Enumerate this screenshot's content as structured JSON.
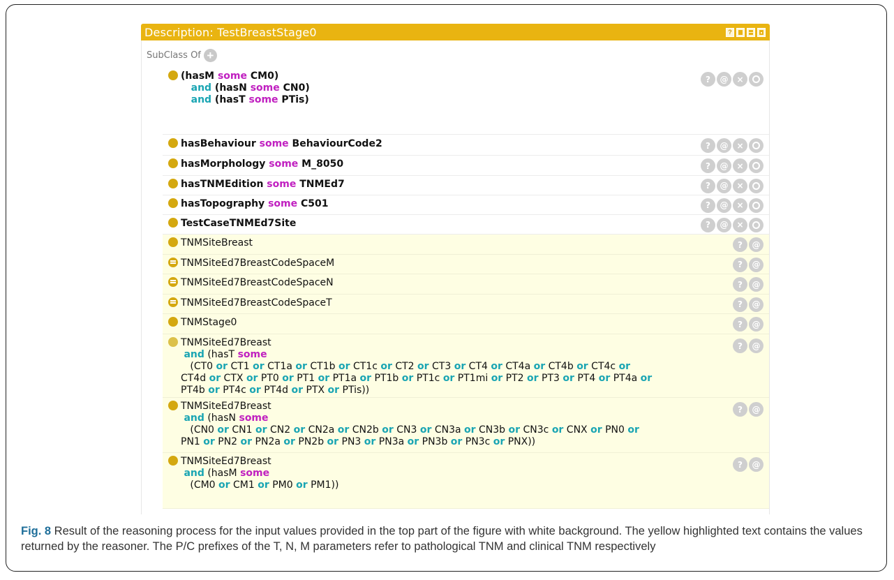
{
  "panel": {
    "title": "Description: TestBreastStage0",
    "title_buttons": [
      "?"
    ],
    "section_label": "SubClass Of",
    "add_icon": "plus-circle-icon"
  },
  "rows": [
    {
      "kind": "asserted",
      "dot": "plain",
      "lines": [
        [
          [
            "t",
            "(hasM "
          ],
          [
            "s",
            "some"
          ],
          [
            "t",
            " CM0)"
          ]
        ],
        [
          [
            "t",
            "   "
          ],
          [
            "a",
            "and"
          ],
          [
            "t",
            " (hasN "
          ],
          [
            "s",
            "some"
          ],
          [
            "t",
            " CN0)"
          ]
        ],
        [
          [
            "t",
            "   "
          ],
          [
            "a",
            "and"
          ],
          [
            "t",
            " (hasT "
          ],
          [
            "s",
            "some"
          ],
          [
            "t",
            " PTis)"
          ]
        ]
      ],
      "actions": [
        "?",
        "@",
        "×",
        "o"
      ]
    },
    {
      "kind": "asserted",
      "dot": "plain",
      "lines": [
        [
          [
            "t",
            "hasBehaviour "
          ],
          [
            "s",
            "some"
          ],
          [
            "t",
            " BehaviourCode2"
          ]
        ]
      ],
      "actions": [
        "?",
        "@",
        "×",
        "o"
      ]
    },
    {
      "kind": "asserted",
      "dot": "plain",
      "lines": [
        [
          [
            "t",
            "hasMorphology "
          ],
          [
            "s",
            "some"
          ],
          [
            "t",
            " M_8050"
          ]
        ]
      ],
      "actions": [
        "?",
        "@",
        "×",
        "o"
      ]
    },
    {
      "kind": "asserted",
      "dot": "plain",
      "lines": [
        [
          [
            "t",
            "hasTNMEdition "
          ],
          [
            "s",
            "some"
          ],
          [
            "t",
            " TNMEd7"
          ]
        ]
      ],
      "actions": [
        "?",
        "@",
        "×",
        "o"
      ]
    },
    {
      "kind": "asserted",
      "dot": "plain",
      "lines": [
        [
          [
            "t",
            "hasTopography "
          ],
          [
            "s",
            "some"
          ],
          [
            "t",
            " C501"
          ]
        ]
      ],
      "actions": [
        "?",
        "@",
        "×",
        "o"
      ]
    },
    {
      "kind": "asserted",
      "dot": "plain",
      "lines": [
        [
          [
            "t",
            "TestCaseTNMEd7Site"
          ]
        ]
      ],
      "actions": [
        "?",
        "@",
        "×",
        "o"
      ]
    },
    {
      "kind": "inferred",
      "dot": "plain",
      "lines": [
        [
          [
            "t",
            "TNMSiteBreast"
          ]
        ]
      ],
      "actions": [
        "?",
        "@"
      ]
    },
    {
      "kind": "inferred",
      "dot": "eq",
      "lines": [
        [
          [
            "t",
            "TNMSiteEd7BreastCodeSpaceM"
          ]
        ]
      ],
      "actions": [
        "?",
        "@"
      ]
    },
    {
      "kind": "inferred",
      "dot": "eq",
      "lines": [
        [
          [
            "t",
            "TNMSiteEd7BreastCodeSpaceN"
          ]
        ]
      ],
      "actions": [
        "?",
        "@"
      ]
    },
    {
      "kind": "inferred",
      "dot": "eq",
      "lines": [
        [
          [
            "t",
            "TNMSiteEd7BreastCodeSpaceT"
          ]
        ]
      ],
      "actions": [
        "?",
        "@"
      ]
    },
    {
      "kind": "inferred",
      "dot": "plain",
      "lines": [
        [
          [
            "t",
            "TNMStage0"
          ]
        ]
      ],
      "actions": [
        "?",
        "@"
      ]
    },
    {
      "kind": "inferred",
      "dot": "light",
      "lines": [
        [
          [
            "t",
            "TNMSiteEd7Breast"
          ]
        ],
        [
          [
            "t",
            " "
          ],
          [
            "a",
            "and"
          ],
          [
            "t",
            " (hasT "
          ],
          [
            "s",
            "some"
          ]
        ],
        [
          [
            "t",
            "   (CT0 "
          ],
          [
            "a",
            "or"
          ],
          [
            "t",
            " CT1 "
          ],
          [
            "a",
            "or"
          ],
          [
            "t",
            " CT1a "
          ],
          [
            "a",
            "or"
          ],
          [
            "t",
            " CT1b "
          ],
          [
            "a",
            "or"
          ],
          [
            "t",
            " CT1c "
          ],
          [
            "a",
            "or"
          ],
          [
            "t",
            " CT2 "
          ],
          [
            "a",
            "or"
          ],
          [
            "t",
            " CT3 "
          ],
          [
            "a",
            "or"
          ],
          [
            "t",
            " CT4 "
          ],
          [
            "a",
            "or"
          ],
          [
            "t",
            " CT4a "
          ],
          [
            "a",
            "or"
          ],
          [
            "t",
            " CT4b "
          ],
          [
            "a",
            "or"
          ],
          [
            "t",
            " CT4c "
          ],
          [
            "a",
            "or"
          ]
        ],
        [
          [
            "t",
            "CT4d "
          ],
          [
            "a",
            "or"
          ],
          [
            "t",
            " CTX "
          ],
          [
            "a",
            "or"
          ],
          [
            "t",
            " PT0 "
          ],
          [
            "a",
            "or"
          ],
          [
            "t",
            " PT1 "
          ],
          [
            "a",
            "or"
          ],
          [
            "t",
            " PT1a "
          ],
          [
            "a",
            "or"
          ],
          [
            "t",
            " PT1b "
          ],
          [
            "a",
            "or"
          ],
          [
            "t",
            " PT1c "
          ],
          [
            "a",
            "or"
          ],
          [
            "t",
            " PT1mi "
          ],
          [
            "a",
            "or"
          ],
          [
            "t",
            " PT2 "
          ],
          [
            "a",
            "or"
          ],
          [
            "t",
            " PT3 "
          ],
          [
            "a",
            "or"
          ],
          [
            "t",
            " PT4 "
          ],
          [
            "a",
            "or"
          ],
          [
            "t",
            " PT4a "
          ],
          [
            "a",
            "or"
          ]
        ],
        [
          [
            "t",
            "PT4b "
          ],
          [
            "a",
            "or"
          ],
          [
            "t",
            " PT4c "
          ],
          [
            "a",
            "or"
          ],
          [
            "t",
            " PT4d "
          ],
          [
            "a",
            "or"
          ],
          [
            "t",
            " PTX "
          ],
          [
            "a",
            "or"
          ],
          [
            "t",
            " PTis))"
          ]
        ]
      ],
      "actions": [
        "?",
        "@"
      ]
    },
    {
      "kind": "inferred",
      "dot": "plain",
      "lines": [
        [
          [
            "t",
            "TNMSiteEd7Breast"
          ]
        ],
        [
          [
            "t",
            " "
          ],
          [
            "a",
            "and"
          ],
          [
            "t",
            " (hasN "
          ],
          [
            "s",
            "some"
          ]
        ],
        [
          [
            "t",
            "   (CN0 "
          ],
          [
            "a",
            "or"
          ],
          [
            "t",
            " CN1 "
          ],
          [
            "a",
            "or"
          ],
          [
            "t",
            " CN2 "
          ],
          [
            "a",
            "or"
          ],
          [
            "t",
            " CN2a "
          ],
          [
            "a",
            "or"
          ],
          [
            "t",
            " CN2b "
          ],
          [
            "a",
            "or"
          ],
          [
            "t",
            " CN3 "
          ],
          [
            "a",
            "or"
          ],
          [
            "t",
            " CN3a "
          ],
          [
            "a",
            "or"
          ],
          [
            "t",
            " CN3b "
          ],
          [
            "a",
            "or"
          ],
          [
            "t",
            " CN3c "
          ],
          [
            "a",
            "or"
          ],
          [
            "t",
            " CNX "
          ],
          [
            "a",
            "or"
          ],
          [
            "t",
            " PN0 "
          ],
          [
            "a",
            "or"
          ]
        ],
        [
          [
            "t",
            "PN1 "
          ],
          [
            "a",
            "or"
          ],
          [
            "t",
            " PN2 "
          ],
          [
            "a",
            "or"
          ],
          [
            "t",
            " PN2a "
          ],
          [
            "a",
            "or"
          ],
          [
            "t",
            " PN2b "
          ],
          [
            "a",
            "or"
          ],
          [
            "t",
            " PN3 "
          ],
          [
            "a",
            "or"
          ],
          [
            "t",
            " PN3a "
          ],
          [
            "a",
            "or"
          ],
          [
            "t",
            " PN3b "
          ],
          [
            "a",
            "or"
          ],
          [
            "t",
            " PN3c "
          ],
          [
            "a",
            "or"
          ],
          [
            "t",
            " PNX))"
          ]
        ]
      ],
      "actions": [
        "?",
        "@"
      ]
    },
    {
      "kind": "inferred",
      "dot": "plain",
      "lines": [
        [
          [
            "t",
            "TNMSiteEd7Breast"
          ]
        ],
        [
          [
            "t",
            " "
          ],
          [
            "a",
            "and"
          ],
          [
            "t",
            " (hasM "
          ],
          [
            "s",
            "some"
          ]
        ],
        [
          [
            "t",
            "   (CM0 "
          ],
          [
            "a",
            "or"
          ],
          [
            "t",
            " CM1 "
          ],
          [
            "a",
            "or"
          ],
          [
            "t",
            " PM0 "
          ],
          [
            "a",
            "or"
          ],
          [
            "t",
            " PM1))"
          ]
        ]
      ],
      "actions": [
        "?",
        "@"
      ]
    }
  ],
  "caption": {
    "label": "Fig. 8",
    "text": " Result of the reasoning process for the input values provided in the top part of the figure with white background. The yellow highlighted text contains the values returned by the reasoner. The P/C prefixes of the T, N, M parameters refer to pathological TNM and clinical TNM respectively"
  },
  "colors": {
    "titlebar": "#e9b411",
    "inferred_bg": "#fefee3",
    "some": "#c020c0",
    "and_or": "#1aa5b3",
    "dot": "#d4a810"
  }
}
